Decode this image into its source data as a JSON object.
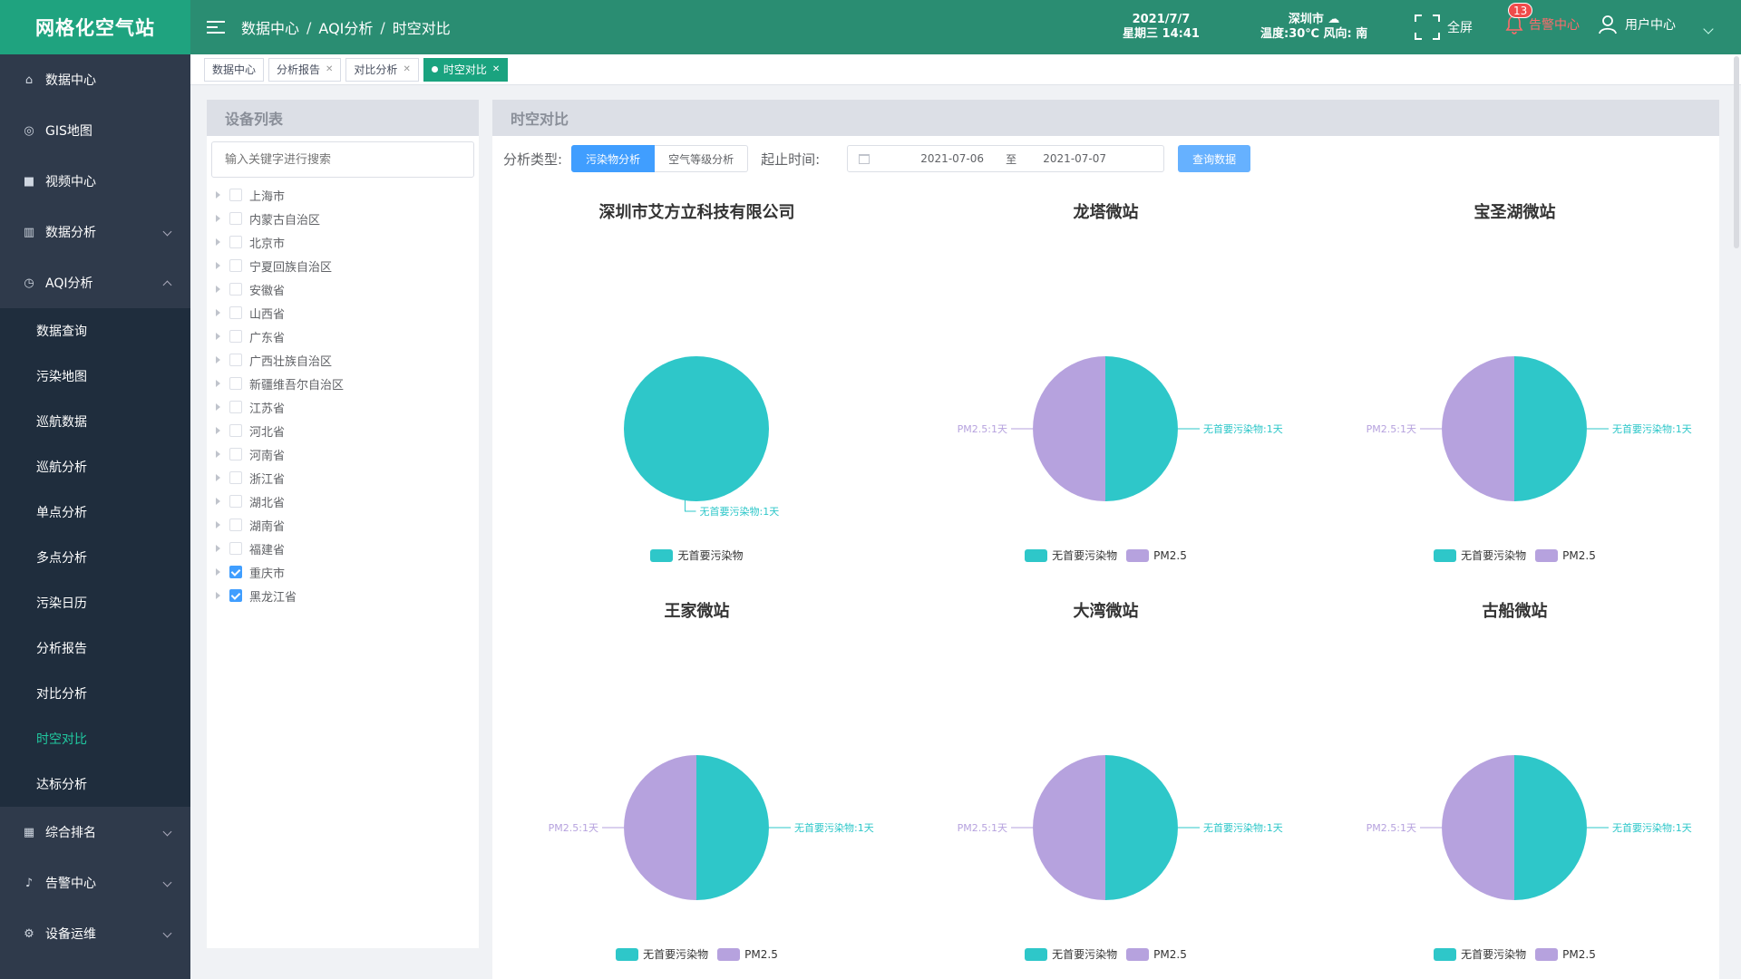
{
  "header": {
    "app_title": "网格化空气站",
    "breadcrumb": [
      "数据中心",
      "AQI分析",
      "时空对比"
    ],
    "breadcrumb_sep": "/",
    "date": "2021/7/7",
    "weekday_time": "星期三 14:41",
    "city": "深圳市",
    "weather": "温度:30℃ 风向: 南",
    "fullscreen_label": "全屏",
    "alarm_label": "告警中心",
    "alarm_count": "13",
    "user_label": "用户中心"
  },
  "sidebar": {
    "items": [
      {
        "label": "数据中心",
        "icon": "home-icon"
      },
      {
        "label": "GIS地图",
        "icon": "map-pin-icon"
      },
      {
        "label": "视频中心",
        "icon": "video-icon"
      },
      {
        "label": "数据分析",
        "icon": "bar-chart-icon"
      },
      {
        "label": "AQI分析",
        "icon": "gauge-icon"
      }
    ],
    "submenu": [
      "数据查询",
      "污染地图",
      "巡航数据",
      "巡航分析",
      "单点分析",
      "多点分析",
      "污染日历",
      "分析报告",
      "对比分析",
      "时空对比",
      "达标分析"
    ],
    "active_sub": "时空对比",
    "bottom_items": [
      {
        "label": "综合排名",
        "icon": "calendar-icon"
      },
      {
        "label": "告警中心",
        "icon": "bell-icon"
      },
      {
        "label": "设备运维",
        "icon": "settings-icon"
      }
    ]
  },
  "tabs": [
    {
      "label": "数据中心",
      "closable": false,
      "active": false
    },
    {
      "label": "分析报告",
      "closable": true,
      "active": false
    },
    {
      "label": "对比分析",
      "closable": true,
      "active": false
    },
    {
      "label": "时空对比",
      "closable": true,
      "active": true
    }
  ],
  "device_panel": {
    "title": "设备列表",
    "search_placeholder": "输入关键字进行搜索",
    "regions": [
      {
        "name": "上海市",
        "checked": false
      },
      {
        "name": "内蒙古自治区",
        "checked": false
      },
      {
        "name": "北京市",
        "checked": false
      },
      {
        "name": "宁夏回族自治区",
        "checked": false
      },
      {
        "name": "安徽省",
        "checked": false
      },
      {
        "name": "山西省",
        "checked": false
      },
      {
        "name": "广东省",
        "checked": false
      },
      {
        "name": "广西壮族自治区",
        "checked": false
      },
      {
        "name": "新疆维吾尔自治区",
        "checked": false
      },
      {
        "name": "江苏省",
        "checked": false
      },
      {
        "name": "河北省",
        "checked": false
      },
      {
        "name": "河南省",
        "checked": false
      },
      {
        "name": "浙江省",
        "checked": false
      },
      {
        "name": "湖北省",
        "checked": false
      },
      {
        "name": "湖南省",
        "checked": false
      },
      {
        "name": "福建省",
        "checked": false
      },
      {
        "name": "重庆市",
        "checked": true
      },
      {
        "name": "黑龙江省",
        "checked": true
      }
    ]
  },
  "main": {
    "title": "时空对比",
    "analysis_type_label": "分析类型:",
    "analysis_types": [
      "污染物分析",
      "空气等级分析"
    ],
    "active_type": "污染物分析",
    "range_label": "起止时间:",
    "start_date": "2021-07-06",
    "range_sep": "至",
    "end_date": "2021-07-07",
    "query_label": "查询数据"
  },
  "colors": {
    "header_bg": "#2a8d72",
    "logo_bg": "#1fa37f",
    "sidebar_bg": "#2f3a4b",
    "submenu_bg": "#1f2d3d",
    "active_text": "#20c9a0",
    "primary_blue": "#409eff",
    "series_none": "#2ec7c9",
    "series_pm25": "#b6a2de"
  },
  "chart_data": [
    {
      "type": "pie",
      "title": "深圳市艾方立科技有限公司",
      "series": [
        {
          "name": "无首要污染物",
          "values": [
            1
          ]
        }
      ],
      "labels": [
        "无首要污染物:1天"
      ],
      "legend": [
        "无首要污染物"
      ]
    },
    {
      "type": "pie",
      "title": "龙塔微站",
      "series": [
        {
          "name": "无首要污染物",
          "values": [
            1
          ]
        },
        {
          "name": "PM2.5",
          "values": [
            1
          ]
        }
      ],
      "labels": [
        "无首要污染物:1天",
        "PM2.5:1天"
      ],
      "legend": [
        "无首要污染物",
        "PM2.5"
      ]
    },
    {
      "type": "pie",
      "title": "宝圣湖微站",
      "series": [
        {
          "name": "无首要污染物",
          "values": [
            1
          ]
        },
        {
          "name": "PM2.5",
          "values": [
            1
          ]
        }
      ],
      "labels": [
        "无首要污染物:1天",
        "PM2.5:1天"
      ],
      "legend": [
        "无首要污染物",
        "PM2.5"
      ]
    },
    {
      "type": "pie",
      "title": "王家微站",
      "series": [
        {
          "name": "无首要污染物",
          "values": [
            1
          ]
        },
        {
          "name": "PM2.5",
          "values": [
            1
          ]
        }
      ],
      "labels": [
        "无首要污染物:1天",
        "PM2.5:1天"
      ],
      "legend": [
        "无首要污染物",
        "PM2.5"
      ]
    },
    {
      "type": "pie",
      "title": "大湾微站",
      "series": [
        {
          "name": "无首要污染物",
          "values": [
            1
          ]
        },
        {
          "name": "PM2.5",
          "values": [
            1
          ]
        }
      ],
      "labels": [
        "无首要污染物:1天",
        "PM2.5:1天"
      ],
      "legend": [
        "无首要污染物",
        "PM2.5"
      ]
    },
    {
      "type": "pie",
      "title": "古船微站",
      "series": [
        {
          "name": "无首要污染物",
          "values": [
            1
          ]
        },
        {
          "name": "PM2.5",
          "values": [
            1
          ]
        }
      ],
      "labels": [
        "无首要污染物:1天",
        "PM2.5:1天"
      ],
      "legend": [
        "无首要污染物",
        "PM2.5"
      ]
    }
  ]
}
